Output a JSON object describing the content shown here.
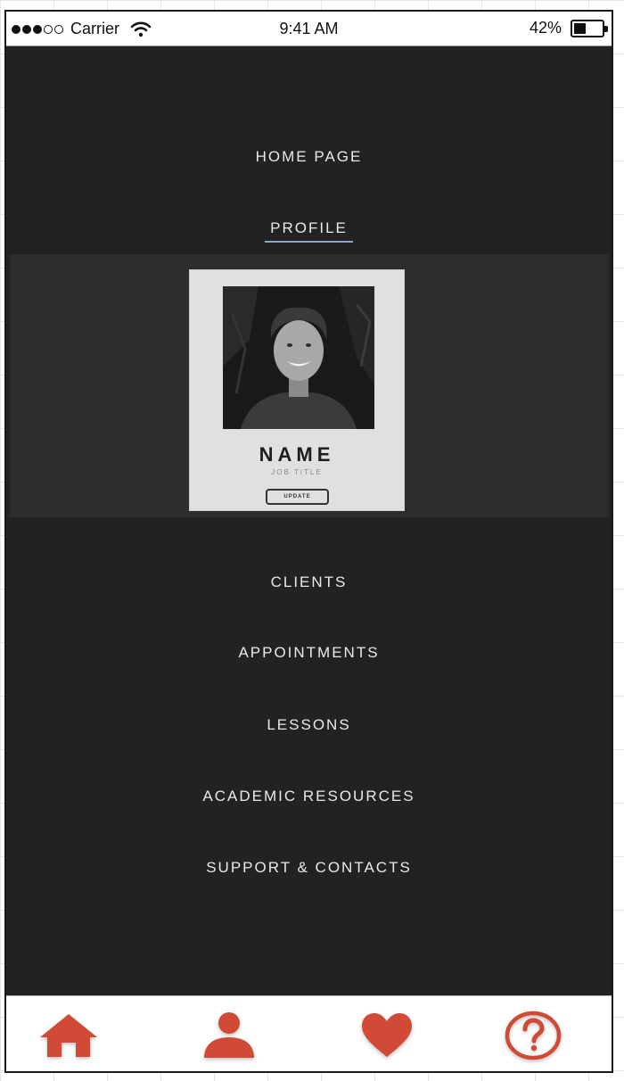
{
  "status_bar": {
    "carrier": "Carrier",
    "time": "9:41 AM",
    "battery_percent": "42%",
    "battery_level": 0.42,
    "signal_bars": 3,
    "signal_total": 5
  },
  "menu": {
    "home": "HOME PAGE",
    "profile": "PROFILE",
    "clients": "CLIENTS",
    "appointments": "APPOINTMENTS",
    "lessons": "LESSONS",
    "academic_resources": "ACADEMIC RESOURCES",
    "support_contacts": "SUPPORT & CONTACTS"
  },
  "profile_card": {
    "name": "NAME",
    "job_title": "JOB TITLE",
    "update_label": "UPDATE"
  },
  "tab_bar": {
    "accent_color": "#d04a35",
    "tabs": [
      {
        "icon": "home-icon"
      },
      {
        "icon": "person-icon"
      },
      {
        "icon": "heart-icon"
      },
      {
        "icon": "help-icon"
      }
    ]
  },
  "colors": {
    "background": "#222222",
    "card": "#e0e0e0",
    "active_underline": "#8fa4c9"
  }
}
